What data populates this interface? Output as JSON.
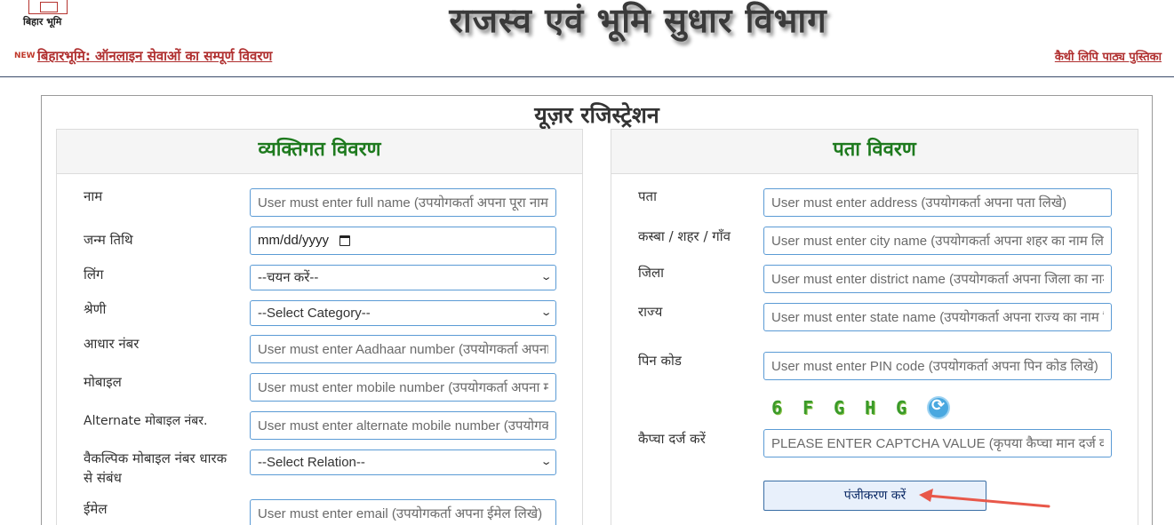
{
  "header": {
    "logo_text": "बिहार भूमि",
    "site_title": "राजस्व एवं भूमि सुधार विभाग",
    "new_badge": "NEW",
    "left_link": "बिहारभूमि: ऑनलाइन सेवाओं का सम्पूर्ण विवरण",
    "right_link": "कैथी लिपि पाठ्य पुस्तिका"
  },
  "form": {
    "title": "यूज़र रजिस्ट्रेशन",
    "personal": {
      "heading": "व्यक्तिगत विवरण",
      "fields": [
        {
          "label": "नाम",
          "placeholder": "User must enter full name (उपयोगकर्ता अपना पूरा नाम लिखे)"
        },
        {
          "label": "जन्म तिथि",
          "value": "mm/dd/yyyy"
        },
        {
          "label": "लिंग",
          "value": "--चयन करें--"
        },
        {
          "label": "श्रेणी",
          "value": "--Select Category--"
        },
        {
          "label": "आधार नंबर",
          "placeholder": "User must enter Aadhaar number (उपयोगकर्ता अपना आधार नंबर लिखे)"
        },
        {
          "label": "मोबाइल",
          "placeholder": "User must enter mobile number (उपयोगकर्ता अपना मोबाइल नंबर लिखे)"
        },
        {
          "label": "Alternate मोबाइल नंबर.",
          "placeholder": "User must enter alternate mobile number (उपयोगकर्ता अपना वैकल्पिक नंबर लिखे)"
        },
        {
          "label": "वैकल्पिक मोबाइल नंबर धारक से संबंध",
          "value": "--Select Relation--"
        },
        {
          "label": "ईमेल",
          "placeholder": "User must enter email (उपयोगकर्ता अपना ईमेल लिखे)"
        }
      ]
    },
    "address": {
      "heading": "पता विवरण",
      "fields": [
        {
          "label": "पता",
          "placeholder": "User must enter address (उपयोगकर्ता अपना पता लिखे)"
        },
        {
          "label": "कस्बा / शहर / गाँव",
          "placeholder": "User must enter city name (उपयोगकर्ता अपना शहर का नाम लिखे)"
        },
        {
          "label": "जिला",
          "placeholder": "User must enter district name (उपयोगकर्ता अपना जिला का नाम लिखे)"
        },
        {
          "label": "राज्य",
          "placeholder": "User must enter state name (उपयोगकर्ता अपना राज्य का नाम लिखे)"
        },
        {
          "label": "पिन कोड",
          "placeholder": "User must enter PIN code (उपयोगकर्ता अपना पिन कोड लिखे)"
        },
        {
          "label": "कैप्चा दर्ज करें",
          "placeholder": "PLEASE ENTER CAPTCHA VALUE (कृपया कैप्चा मान दर्ज करें)"
        }
      ],
      "captcha_chars": [
        "6",
        "F",
        "G",
        "H",
        "G"
      ],
      "register_label": "पंजीकरण करें"
    }
  }
}
